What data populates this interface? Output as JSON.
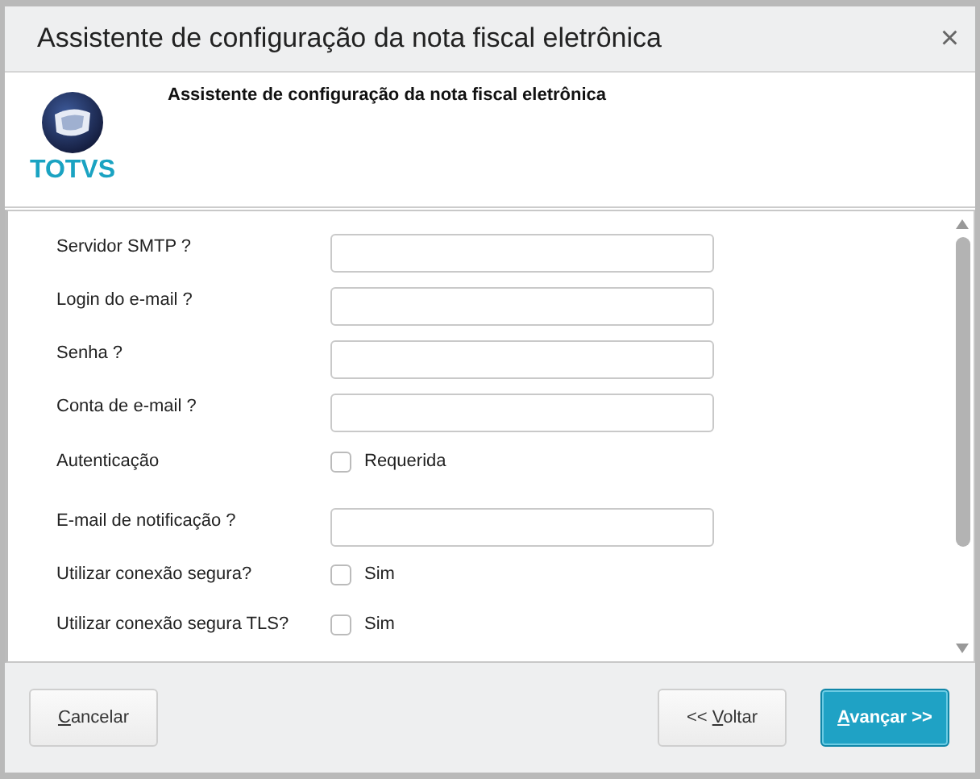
{
  "window": {
    "title": "Assistente de configuração da nota fiscal eletrônica",
    "close": "×"
  },
  "header": {
    "logo_text": "TOTVS",
    "title": "Assistente de configuração da nota fiscal eletrônica"
  },
  "form": {
    "rows": [
      {
        "kind": "text",
        "label": "Servidor SMTP ?"
      },
      {
        "kind": "text",
        "label": "Login do e-mail ?"
      },
      {
        "kind": "text",
        "label": "Senha ?"
      },
      {
        "kind": "text",
        "label": "Conta de e-mail ?"
      },
      {
        "kind": "checkbox",
        "label": "Autenticação",
        "option": "Requerida",
        "checked": false
      },
      {
        "kind": "text",
        "label": "E-mail de notificação ?"
      },
      {
        "kind": "checkbox",
        "label": "Utilizar conexão segura?",
        "option": "Sim",
        "checked": false
      },
      {
        "kind": "checkbox",
        "label": "Utilizar conexão segura TLS?",
        "option": "Sim",
        "checked": false
      }
    ]
  },
  "buttons": [
    {
      "kind": "cancel",
      "key": "C",
      "post": "ancelar",
      "primary": false
    },
    {
      "kind": "back",
      "pre": "<< ",
      "key": "V",
      "post": "oltar",
      "primary": false
    },
    {
      "kind": "next",
      "key": "A",
      "post": "vançar >>",
      "primary": true
    }
  ]
}
